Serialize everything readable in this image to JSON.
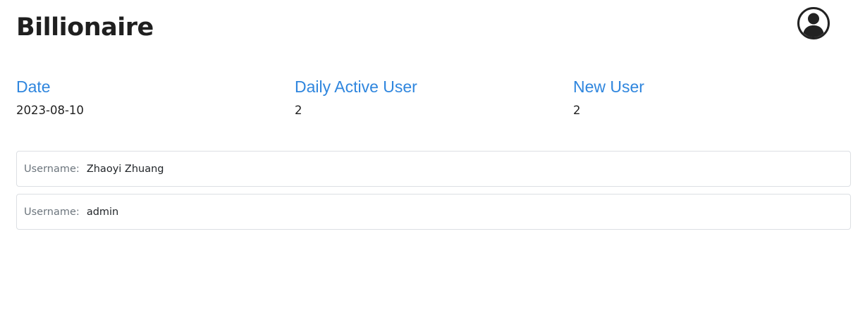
{
  "header": {
    "title": "Billionaire",
    "avatar_icon": "user-circle-icon"
  },
  "stats": [
    {
      "label": "Date",
      "value": "2023-08-10"
    },
    {
      "label": "Daily Active User",
      "value": "2"
    },
    {
      "label": "New User",
      "value": "2"
    }
  ],
  "users": [
    {
      "label": "Username:",
      "value": "Zhaoyi Zhuang"
    },
    {
      "label": "Username:",
      "value": "admin"
    }
  ],
  "colors": {
    "accent": "#2f86de",
    "text": "#1f1f1f",
    "muted": "#6c757d",
    "border": "#dcdfe3"
  }
}
